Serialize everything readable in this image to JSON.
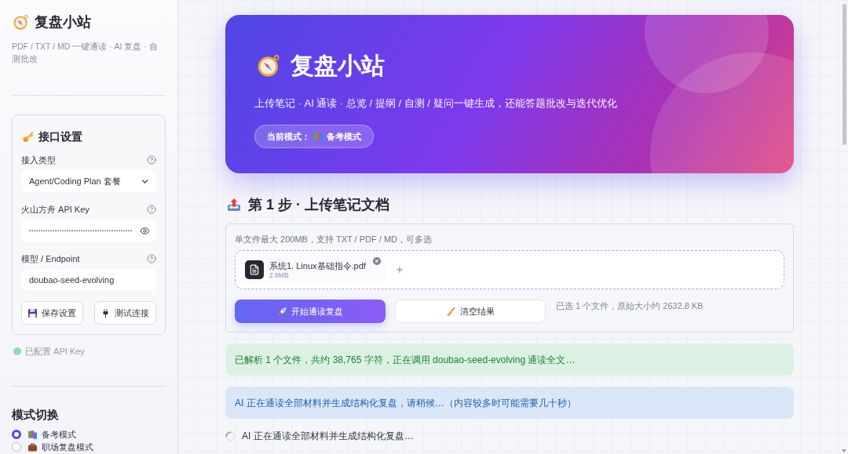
{
  "sidebar": {
    "title": "复盘小站",
    "subtitle": "PDF / TXT / MD 一键通读 · AI 复盘 · 自测批改",
    "settings": {
      "title": "接口设置",
      "fields": [
        {
          "kind": "select",
          "label": "接入类型",
          "value": "Agent/Coding Plan 套餐"
        },
        {
          "kind": "password",
          "label": "火山方舟 API Key",
          "value": "••••••••••••••••••••••••••••••••••••••••••••"
        },
        {
          "kind": "text",
          "label": "模型 / Endpoint",
          "value": "doubao-seed-evolving"
        }
      ],
      "buttons": [
        {
          "label": "保存设置"
        },
        {
          "label": "测试连接"
        }
      ]
    },
    "status": {
      "configured": true,
      "text": "已配置 API Key"
    },
    "modes": {
      "title": "模式切换",
      "options": [
        {
          "label": "备考模式",
          "selected": true
        },
        {
          "label": "职场复盘模式",
          "selected": false
        }
      ]
    }
  },
  "hero": {
    "title": "复盘小站",
    "subtitle": "上传笔记 · AI 通读 · 总览 / 提纲 / 自测 / 疑问一键生成，还能答题批改与迭代优化",
    "mode_label": "当前模式：",
    "mode_value": "备考模式"
  },
  "upload": {
    "title": "第 1 步 · 上传笔记文档",
    "hint": "单文件最大 200MB，支持 TXT / PDF / MD，可多选",
    "files": [
      {
        "name": "系统1. Linux基础指令.pdf",
        "size": "2.6MB"
      }
    ],
    "buttons": [
      {
        "kind": "primary",
        "label": "开始通读复盘"
      },
      {
        "kind": "secondary",
        "label": "清空结果"
      }
    ],
    "summary": "已选 1 个文件，原始大小约 2632.8 KB"
  },
  "alerts": [
    {
      "kind": "success",
      "text": "已解析 1 个文件，共约 38,765 字符，正在调用 doubao-seed-evolving 通读全文…"
    },
    {
      "kind": "info",
      "text": "AI 正在通读全部材料并生成结构化复盘，请稍候…（内容较多时可能需要几十秒）"
    }
  ],
  "spinner": {
    "text": "AI 正在通读全部材料并生成结构化复盘…"
  }
}
